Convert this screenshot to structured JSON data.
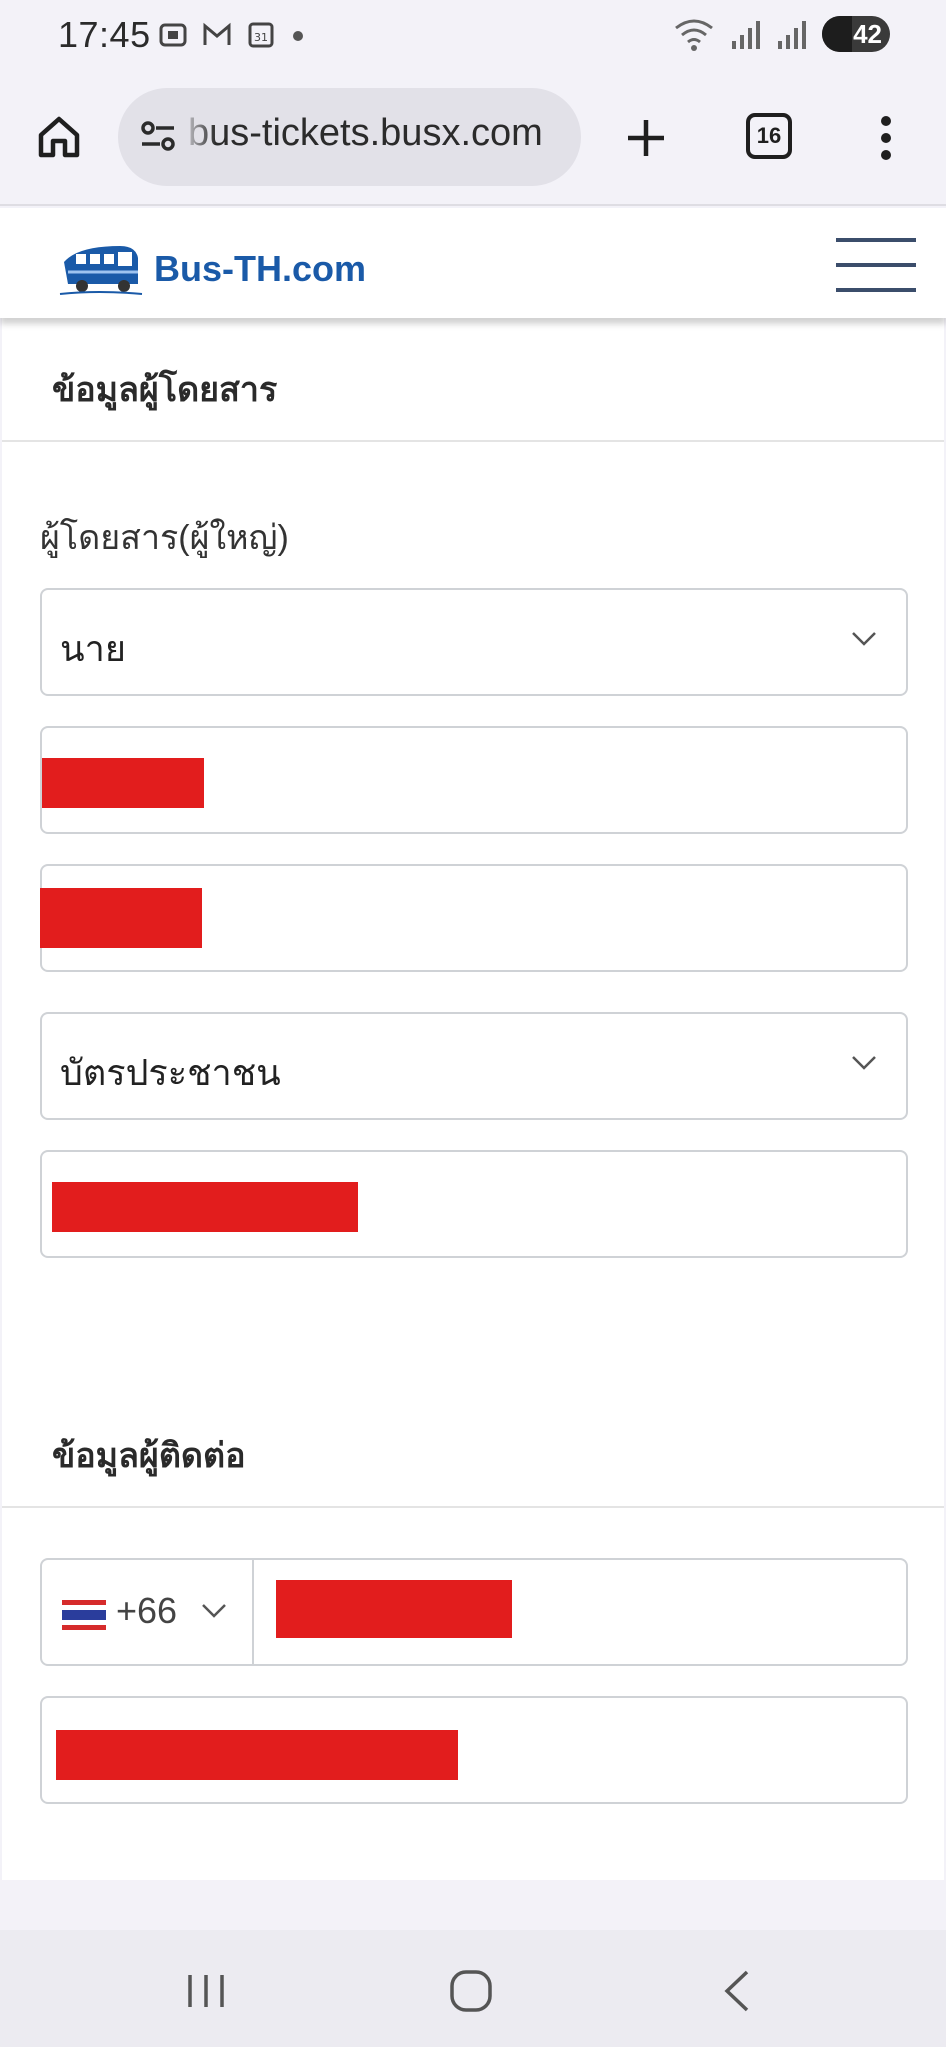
{
  "status_bar": {
    "time": "17:45",
    "battery": "42"
  },
  "browser": {
    "url": "bus-tickets.busx.com",
    "tab_count": "16"
  },
  "site": {
    "logo_text": "Bus-TH.com"
  },
  "passenger_section": {
    "title": "ข้อมูลผู้โดยสาร",
    "passenger_label": "ผู้โดยสาร(ผู้ใหญ่)",
    "title_select_value": "นาย",
    "id_type_select_value": "บัตรประชาชน"
  },
  "contact_section": {
    "title": "ข้อมูลผู้ติดต่อ",
    "country_code": "+66"
  },
  "colors": {
    "brand_blue": "#1a5aa8",
    "redaction": "#e21d1d"
  },
  "icons": {
    "home": "home-icon",
    "tune": "tune-icon",
    "plus": "plus-icon",
    "more": "more-vert-icon",
    "menu": "hamburger-icon",
    "chevron": "chevron-down-icon"
  }
}
